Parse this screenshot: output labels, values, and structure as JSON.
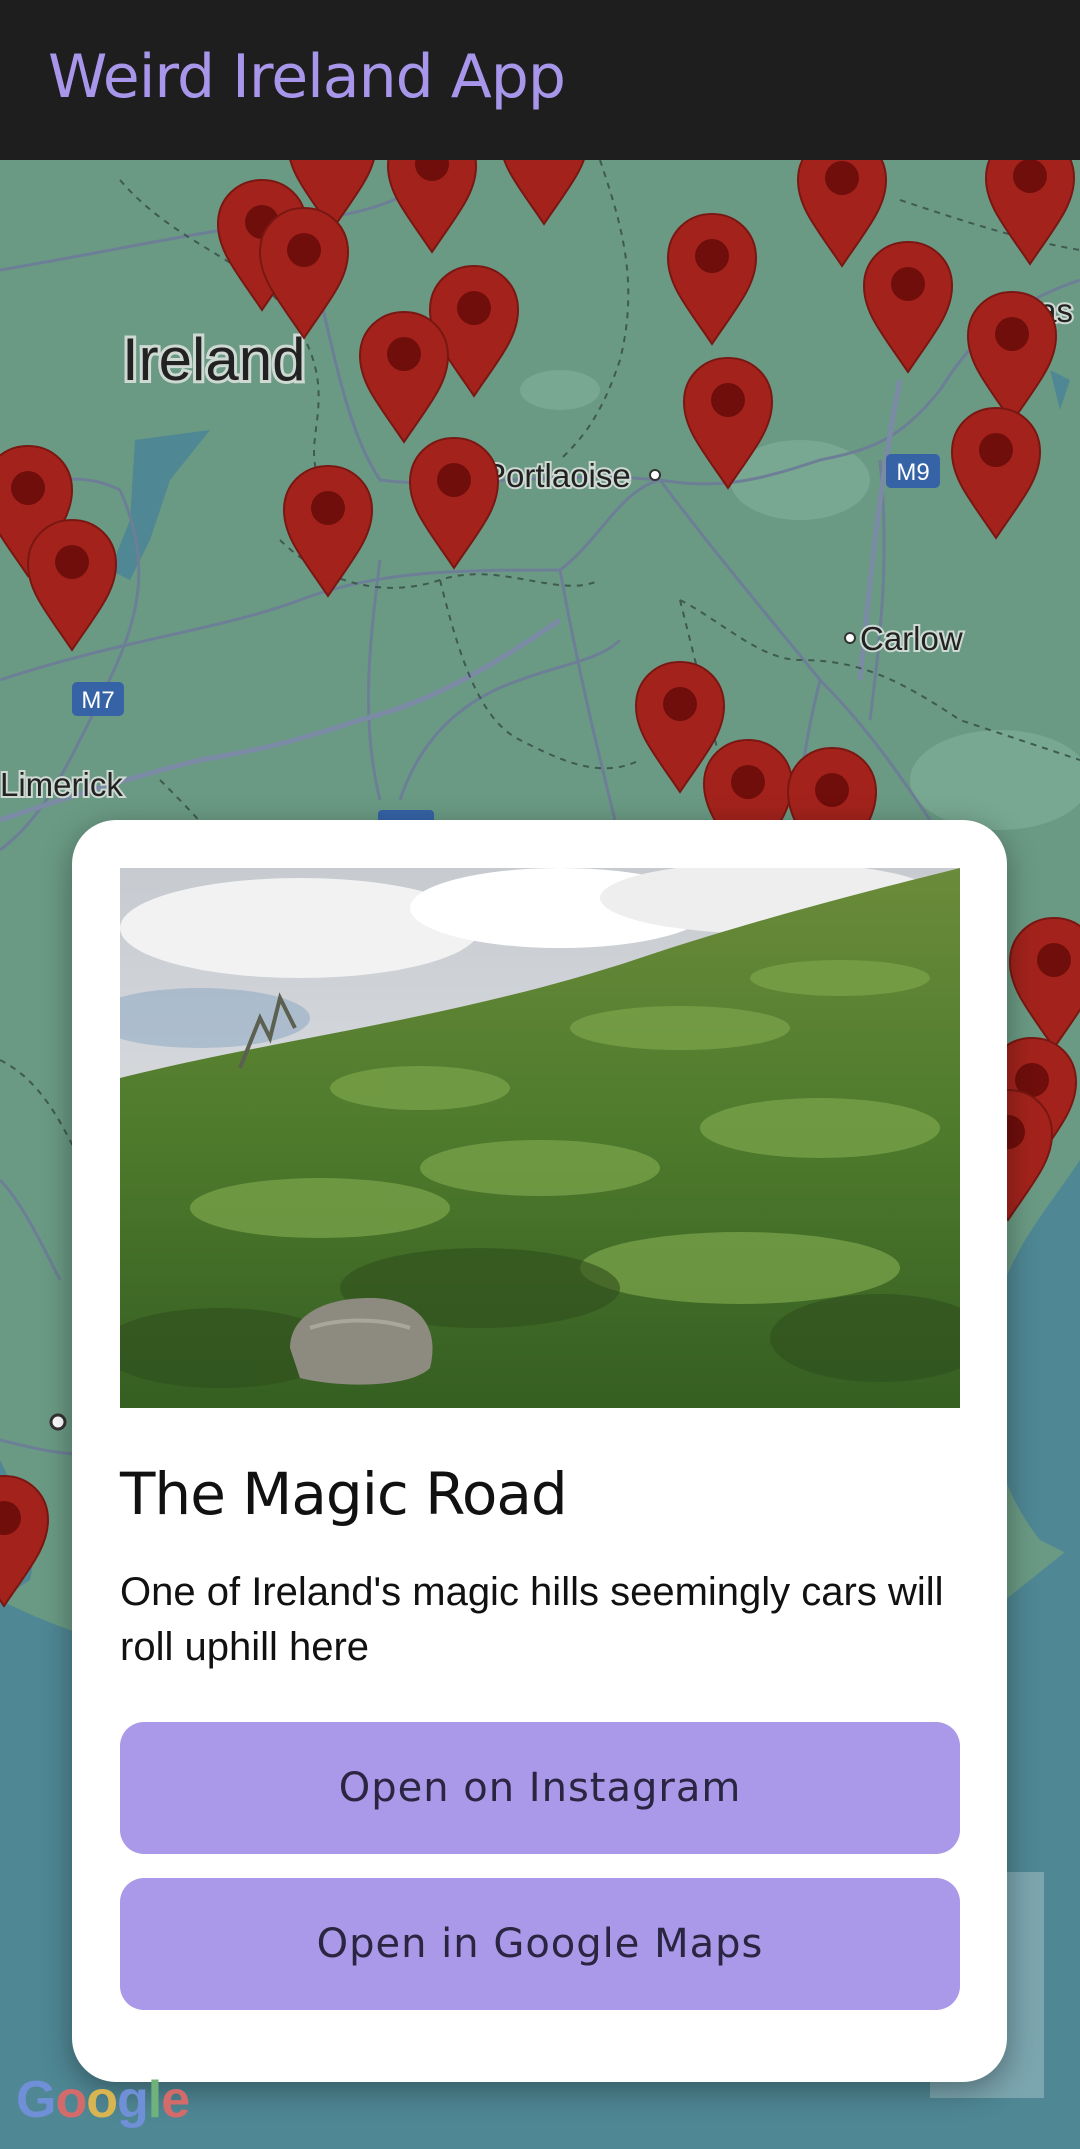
{
  "app": {
    "title": "Weird Ireland App"
  },
  "map": {
    "labels": {
      "ireland": "Ireland",
      "portlaoise": "Portlaoise",
      "carlow": "Carlow",
      "limerick": "Limerick",
      "naas": "Naas",
      "m9": "M9",
      "m7": "M7"
    },
    "colors": {
      "land": "#6a9a84",
      "sea": "#4f8794",
      "pin": "#a3231c",
      "pin_dot": "#6f0e0b",
      "road": "#6d7f96"
    },
    "attribution": [
      "G",
      "o",
      "o",
      "g",
      "l",
      "e"
    ]
  },
  "card": {
    "title": "The Magic Road",
    "description": "One of Ireland's magic hills seemingly cars will roll uphill here",
    "buttons": {
      "instagram": "Open on Instagram",
      "maps": "Open in Google Maps"
    }
  }
}
